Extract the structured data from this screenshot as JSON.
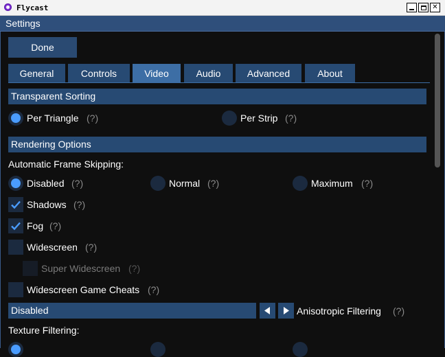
{
  "window": {
    "title": "Flycast",
    "minimize": "",
    "maximize": "",
    "close": "✕"
  },
  "header": {
    "title": "Settings"
  },
  "toolbar": {
    "done_label": "Done"
  },
  "tabs": [
    {
      "label": "General"
    },
    {
      "label": "Controls"
    },
    {
      "label": "Video"
    },
    {
      "label": "Audio"
    },
    {
      "label": "Advanced"
    },
    {
      "label": "About"
    }
  ],
  "active_tab": "Video",
  "transparent_sorting": {
    "title": "Transparent Sorting",
    "options": [
      {
        "label": "Per Triangle",
        "help": "(?)",
        "selected": true
      },
      {
        "label": "Per Strip",
        "help": "(?)",
        "selected": false
      }
    ]
  },
  "rendering": {
    "title": "Rendering Options",
    "frame_skip_label": "Automatic Frame Skipping:",
    "frame_skip_options": [
      {
        "label": "Disabled",
        "help": "(?)",
        "selected": true
      },
      {
        "label": "Normal",
        "help": "(?)",
        "selected": false
      },
      {
        "label": "Maximum",
        "help": "(?)",
        "selected": false
      }
    ],
    "checks": [
      {
        "label": "Shadows",
        "help": "(?)",
        "checked": true
      },
      {
        "label": "Fog",
        "help": "(?)",
        "checked": true
      },
      {
        "label": "Widescreen",
        "help": "(?)",
        "checked": false
      },
      {
        "label": "Super Widescreen",
        "help": "(?)",
        "checked": false,
        "disabled": true
      },
      {
        "label": "Widescreen Game Cheats",
        "help": "(?)",
        "checked": false
      }
    ],
    "anisotropic": {
      "value": "Disabled",
      "label": "Anisotropic Filtering",
      "help": "(?)"
    },
    "texture_filter_label": "Texture Filtering:"
  },
  "colors": {
    "accent": "#4a9cff",
    "panel": "#274a73",
    "active_tab": "#3d6ea5",
    "background": "#0f0f0f"
  }
}
